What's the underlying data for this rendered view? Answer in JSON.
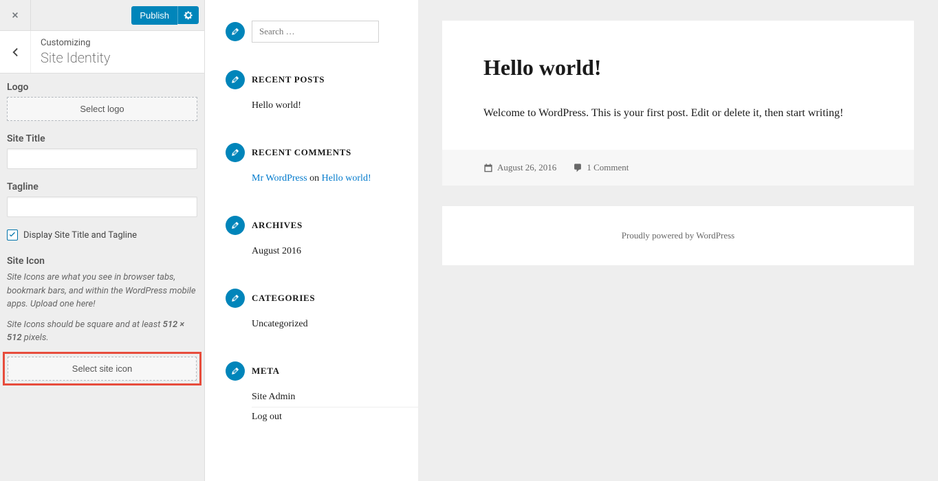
{
  "customizer": {
    "publish_label": "Publish",
    "breadcrumb": "Customizing",
    "section_title": "Site Identity",
    "logo": {
      "label": "Logo",
      "button": "Select logo"
    },
    "site_title": {
      "label": "Site Title",
      "value": ""
    },
    "tagline": {
      "label": "Tagline",
      "value": ""
    },
    "display_checkbox": {
      "label": "Display Site Title and Tagline",
      "checked": true
    },
    "site_icon": {
      "label": "Site Icon",
      "help1_a": "Site Icons are what you see in browser tabs, bookmark bars, and within the WordPress mobile apps. Upload one here!",
      "help2_a": "Site Icons should be square and at least ",
      "help2_b": "512 × 512",
      "help2_c": " pixels.",
      "button": "Select site icon"
    }
  },
  "preview": {
    "search": {
      "placeholder": "Search …"
    },
    "widgets": {
      "recent_posts": {
        "title": "RECENT POSTS",
        "items": [
          "Hello world!"
        ]
      },
      "recent_comments": {
        "title": "RECENT COMMENTS",
        "author": "Mr WordPress",
        "on": " on ",
        "post": "Hello world!"
      },
      "archives": {
        "title": "ARCHIVES",
        "items": [
          "August 2016"
        ]
      },
      "categories": {
        "title": "CATEGORIES",
        "items": [
          "Uncategorized"
        ]
      },
      "meta": {
        "title": "META",
        "items": [
          "Site Admin",
          "Log out"
        ]
      }
    },
    "post": {
      "title": "Hello world!",
      "body": "Welcome to WordPress. This is your first post. Edit or delete it, then start writing!",
      "date": "August 26, 2016",
      "comments": "1 Comment"
    },
    "footer": "Proudly powered by WordPress"
  }
}
